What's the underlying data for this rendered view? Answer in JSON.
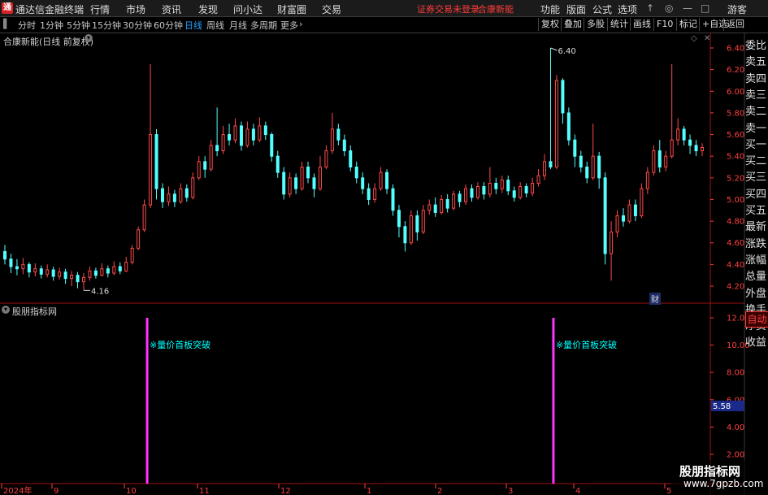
{
  "menu": {
    "app_name": "通达信金融终端",
    "items": [
      "行情",
      "市场",
      "资讯",
      "发现",
      "问小达",
      "财富圈",
      "交易"
    ],
    "warning": "证券交易未登录",
    "stock": "合康新能",
    "right_items": [
      "功能",
      "版面",
      "公式",
      "选项"
    ],
    "guest": "游客",
    "icons": [
      "arrow-up-icon",
      "search-icon",
      "minimize-icon",
      "maximize-icon",
      "close-icon"
    ]
  },
  "toolbar": {
    "periods": [
      "分时",
      "1分钟",
      "5分钟",
      "15分钟",
      "30分钟",
      "60分钟",
      "日线",
      "周线",
      "月线",
      "多周期",
      "更多"
    ],
    "active_period": "日线",
    "buttons": [
      "复权",
      "叠加",
      "多股",
      "统计",
      "画线",
      "F10",
      "标记",
      "+自选",
      "返回"
    ]
  },
  "chart_title": "合康新能(日线 前复权)",
  "indicator_title": "股朋指标网",
  "sidebar": [
    "委比",
    "卖五",
    "卖四",
    "卖三",
    "卖二",
    "卖一",
    "买一",
    "买二",
    "买三",
    "买四",
    "买五",
    "最新",
    "涨跌",
    "涨幅",
    "总量",
    "外盘",
    "换手",
    "净资",
    "收益"
  ],
  "auto_label": "自动",
  "event_badge": "财",
  "watermark": {
    "name": "股朋指标网",
    "url": "www.7gpzb.com"
  },
  "chart_data": [
    {
      "type": "candlestick",
      "title": "合康新能(日线 前复权)",
      "y_ticks": [
        6.4,
        6.2,
        6.0,
        5.8,
        5.6,
        5.4,
        5.2,
        5.0,
        4.8,
        4.6,
        4.4,
        4.2
      ],
      "ylim": [
        4.1,
        6.5
      ],
      "annotations": [
        {
          "label": "6.40",
          "value": 6.4,
          "kind": "high"
        },
        {
          "label": "4.16",
          "value": 4.16,
          "kind": "low"
        }
      ],
      "x_labels": [
        "2024年",
        "9",
        "10",
        "11",
        "12",
        "1",
        "2",
        "3",
        "4",
        "5"
      ],
      "colors": {
        "up": "#ff4a4a",
        "down": "#54ffff"
      },
      "candles": [
        [
          4.52,
          4.45,
          4.58,
          4.4
        ],
        [
          4.45,
          4.38,
          4.5,
          4.32
        ],
        [
          4.38,
          4.36,
          4.45,
          4.3
        ],
        [
          4.36,
          4.4,
          4.46,
          4.31
        ],
        [
          4.4,
          4.33,
          4.42,
          4.28
        ],
        [
          4.33,
          4.36,
          4.41,
          4.29
        ],
        [
          4.36,
          4.31,
          4.39,
          4.27
        ],
        [
          4.31,
          4.35,
          4.4,
          4.28
        ],
        [
          4.35,
          4.29,
          4.38,
          4.25
        ],
        [
          4.29,
          4.33,
          4.37,
          4.26
        ],
        [
          4.33,
          4.27,
          4.36,
          4.22
        ],
        [
          4.27,
          4.3,
          4.34,
          4.2
        ],
        [
          4.3,
          4.24,
          4.33,
          4.18
        ],
        [
          4.24,
          4.28,
          4.32,
          4.16
        ],
        [
          4.28,
          4.34,
          4.38,
          4.25
        ],
        [
          4.34,
          4.3,
          4.37,
          4.27
        ],
        [
          4.3,
          4.36,
          4.41,
          4.29
        ],
        [
          4.36,
          4.32,
          4.39,
          4.28
        ],
        [
          4.32,
          4.38,
          4.43,
          4.3
        ],
        [
          4.38,
          4.34,
          4.42,
          4.31
        ],
        [
          4.34,
          4.42,
          4.47,
          4.33
        ],
        [
          4.42,
          4.55,
          4.58,
          4.4
        ],
        [
          4.55,
          4.72,
          4.75,
          4.53
        ],
        [
          4.72,
          4.95,
          5.0,
          4.7
        ],
        [
          4.95,
          5.6,
          6.25,
          4.92
        ],
        [
          5.6,
          5.1,
          5.65,
          5.0
        ],
        [
          5.1,
          4.98,
          5.15,
          4.92
        ],
        [
          4.98,
          5.05,
          5.12,
          4.94
        ],
        [
          5.05,
          4.98,
          5.09,
          4.93
        ],
        [
          4.98,
          5.1,
          5.15,
          4.96
        ],
        [
          5.1,
          5.02,
          5.14,
          4.98
        ],
        [
          5.02,
          5.2,
          5.25,
          5.0
        ],
        [
          5.2,
          5.35,
          5.4,
          5.18
        ],
        [
          5.35,
          5.28,
          5.4,
          5.2
        ],
        [
          5.28,
          5.5,
          5.55,
          5.26
        ],
        [
          5.5,
          5.45,
          5.85,
          5.4
        ],
        [
          5.45,
          5.6,
          5.68,
          5.42
        ],
        [
          5.6,
          5.55,
          5.7,
          5.5
        ],
        [
          5.55,
          5.68,
          5.75,
          5.52
        ],
        [
          5.68,
          5.5,
          5.72,
          5.45
        ],
        [
          5.5,
          5.65,
          5.72,
          5.48
        ],
        [
          5.65,
          5.55,
          5.7,
          5.5
        ],
        [
          5.55,
          5.68,
          5.76,
          5.53
        ],
        [
          5.68,
          5.6,
          5.72,
          5.55
        ],
        [
          5.6,
          5.4,
          5.62,
          5.35
        ],
        [
          5.4,
          5.25,
          5.45,
          5.2
        ],
        [
          5.25,
          5.05,
          5.3,
          5.0
        ],
        [
          5.05,
          5.2,
          5.25,
          5.02
        ],
        [
          5.2,
          5.1,
          5.24,
          5.05
        ],
        [
          5.1,
          5.3,
          5.35,
          5.08
        ],
        [
          5.3,
          5.2,
          5.35,
          5.15
        ],
        [
          5.2,
          5.1,
          5.24,
          5.02
        ],
        [
          5.1,
          5.3,
          5.4,
          5.08
        ],
        [
          5.3,
          5.45,
          5.5,
          5.28
        ],
        [
          5.45,
          5.65,
          5.8,
          5.42
        ],
        [
          5.65,
          5.55,
          5.7,
          5.5
        ],
        [
          5.55,
          5.45,
          5.6,
          5.4
        ],
        [
          5.45,
          5.3,
          5.5,
          5.26
        ],
        [
          5.3,
          5.2,
          5.35,
          5.15
        ],
        [
          5.2,
          5.1,
          5.25,
          5.05
        ],
        [
          5.1,
          5.0,
          5.15,
          4.95
        ],
        [
          5.0,
          5.1,
          5.15,
          4.97
        ],
        [
          5.1,
          5.25,
          5.3,
          5.08
        ],
        [
          5.25,
          5.1,
          5.28,
          5.05
        ],
        [
          5.1,
          4.9,
          5.14,
          4.85
        ],
        [
          4.9,
          4.75,
          4.95,
          4.65
        ],
        [
          4.75,
          4.6,
          4.8,
          4.52
        ],
        [
          4.6,
          4.85,
          4.9,
          4.58
        ],
        [
          4.85,
          4.7,
          4.9,
          4.62
        ],
        [
          4.7,
          4.9,
          4.95,
          4.68
        ],
        [
          4.9,
          4.95,
          5.0,
          4.86
        ],
        [
          4.95,
          4.88,
          5.02,
          4.84
        ],
        [
          4.88,
          5.0,
          5.04,
          4.86
        ],
        [
          5.0,
          4.92,
          5.05,
          4.88
        ],
        [
          4.92,
          5.05,
          5.08,
          4.9
        ],
        [
          5.05,
          4.98,
          5.08,
          4.93
        ],
        [
          4.98,
          5.1,
          5.14,
          4.95
        ],
        [
          5.1,
          5.02,
          5.14,
          4.98
        ],
        [
          5.02,
          5.12,
          5.16,
          5.0
        ],
        [
          5.12,
          5.05,
          5.16,
          5.0
        ],
        [
          5.05,
          5.15,
          5.3,
          5.02
        ],
        [
          5.15,
          5.1,
          5.2,
          5.05
        ],
        [
          5.1,
          5.18,
          5.22,
          5.06
        ],
        [
          5.18,
          5.08,
          5.22,
          5.04
        ],
        [
          5.08,
          5.02,
          5.12,
          4.98
        ],
        [
          5.02,
          5.12,
          5.16,
          5.0
        ],
        [
          5.12,
          5.06,
          5.15,
          5.02
        ],
        [
          5.06,
          5.15,
          5.2,
          5.03
        ],
        [
          5.15,
          5.22,
          5.28,
          5.12
        ],
        [
          5.22,
          5.35,
          5.42,
          5.18
        ],
        [
          5.35,
          5.3,
          6.4,
          5.28
        ],
        [
          5.3,
          6.1,
          6.15,
          5.28
        ],
        [
          6.1,
          5.8,
          6.12,
          5.7
        ],
        [
          5.8,
          5.55,
          5.85,
          5.5
        ],
        [
          5.55,
          5.4,
          5.6,
          5.3
        ],
        [
          5.4,
          5.3,
          5.45,
          5.25
        ],
        [
          5.3,
          5.2,
          5.35,
          5.15
        ],
        [
          5.2,
          5.4,
          5.7,
          5.18
        ],
        [
          5.4,
          5.2,
          5.44,
          5.1
        ],
        [
          5.2,
          4.5,
          5.25,
          4.4
        ],
        [
          4.5,
          4.7,
          4.8,
          4.25
        ],
        [
          4.7,
          4.85,
          4.9,
          4.65
        ],
        [
          4.85,
          4.8,
          4.92,
          4.75
        ],
        [
          4.8,
          4.95,
          5.0,
          4.78
        ],
        [
          4.95,
          4.85,
          5.0,
          4.8
        ],
        [
          4.85,
          5.1,
          5.15,
          4.83
        ],
        [
          5.1,
          5.25,
          5.3,
          5.05
        ],
        [
          5.25,
          5.45,
          5.5,
          5.22
        ],
        [
          5.45,
          5.3,
          5.55,
          5.25
        ],
        [
          5.3,
          5.4,
          5.45,
          5.26
        ],
        [
          5.4,
          5.55,
          6.25,
          5.38
        ],
        [
          5.55,
          5.65,
          5.75,
          5.5
        ],
        [
          5.65,
          5.55,
          5.68,
          5.5
        ],
        [
          5.55,
          5.5,
          5.6,
          5.42
        ],
        [
          5.5,
          5.45,
          5.55,
          5.4
        ],
        [
          5.45,
          5.48,
          5.52,
          5.4
        ]
      ]
    },
    {
      "type": "bar",
      "title": "股朋指标网",
      "y_ticks": [
        12.0,
        10.0,
        8.0,
        6.0,
        4.0,
        2.0
      ],
      "ylim": [
        1.0,
        13.0
      ],
      "current_value": 5.58,
      "signals": [
        {
          "candle_index": 24,
          "label": "※量价首板突破"
        },
        {
          "candle_index": 91,
          "label": "※量价首板突破"
        }
      ],
      "colors": {
        "signal": "#ff33ff",
        "label": "#00ffff"
      }
    }
  ]
}
